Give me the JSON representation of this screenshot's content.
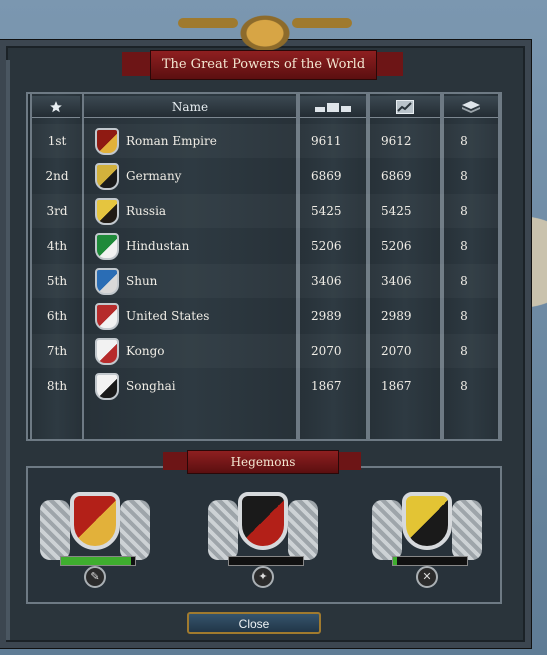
{
  "window": {
    "title": "The Great Powers of the World",
    "close_label": "Close"
  },
  "table": {
    "headers": {
      "rank_icon": "star-icon",
      "name": "Name",
      "score_icon": "score-bars-icon",
      "score_trend_icon": "trend-chart-icon",
      "modifier_icon": "stacked-layer-icon"
    },
    "rows": [
      {
        "rank": "1st",
        "name": "Roman Empire",
        "v1": "9611",
        "v2": "9612",
        "v3": "8",
        "flag_colors": [
          "#8f1a12",
          "#e2b13a"
        ]
      },
      {
        "rank": "2nd",
        "name": "Germany",
        "v1": "6869",
        "v2": "6869",
        "v3": "8",
        "flag_colors": [
          "#d2b13c",
          "#1a1a1a"
        ]
      },
      {
        "rank": "3rd",
        "name": "Russia",
        "v1": "5425",
        "v2": "5425",
        "v3": "8",
        "flag_colors": [
          "#e5c53f",
          "#201a14"
        ]
      },
      {
        "rank": "4th",
        "name": "Hindustan",
        "v1": "5206",
        "v2": "5206",
        "v3": "8",
        "flag_colors": [
          "#1f8a3a",
          "#f2f2f2"
        ]
      },
      {
        "rank": "5th",
        "name": "Shun",
        "v1": "3406",
        "v2": "3406",
        "v3": "8",
        "flag_colors": [
          "#2a6db5",
          "#d8d8d8"
        ]
      },
      {
        "rank": "6th",
        "name": "United States",
        "v1": "2989",
        "v2": "2989",
        "v3": "8",
        "flag_colors": [
          "#b62b2b",
          "#f2f2f2"
        ]
      },
      {
        "rank": "7th",
        "name": "Kongo",
        "v1": "2070",
        "v2": "2070",
        "v3": "8",
        "flag_colors": [
          "#f2f2f2",
          "#b62b2b"
        ]
      },
      {
        "rank": "8th",
        "name": "Songhai",
        "v1": "1867",
        "v2": "1867",
        "v3": "8",
        "flag_colors": [
          "#f2f2f2",
          "#1a1a1a"
        ]
      }
    ]
  },
  "hegemons": {
    "title": "Hegemons",
    "items": [
      {
        "crest_colors": [
          "#b32018",
          "#e2b13a"
        ],
        "progress": 0.95,
        "icon": "economic-hegemony-icon"
      },
      {
        "crest_colors": [
          "#1a1a1a",
          "#b32018"
        ],
        "progress": 0,
        "icon": "naval-hegemony-icon"
      },
      {
        "crest_colors": [
          "#e3c434",
          "#1a1a1a"
        ],
        "progress": 0.05,
        "icon": "military-hegemony-icon"
      }
    ]
  }
}
